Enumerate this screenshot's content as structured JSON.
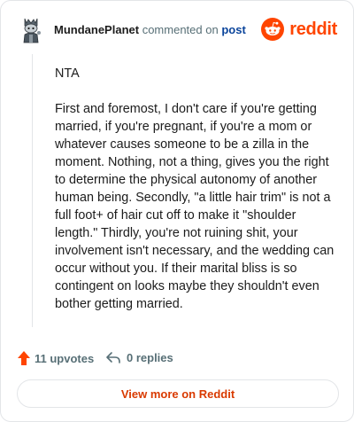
{
  "header": {
    "username": "MundanePlanet",
    "verb": "commented on",
    "post_link": "post",
    "brand": "reddit"
  },
  "comment": {
    "paragraphs": [
      "NTA",
      "First and foremost, I don't care if you're getting married, if you're pregnant, if you're a mom or whatever causes someone to be a zilla in the moment. Nothing, not a thing, gives you the right to determine the physical autonomy of another human being. Secondly, \"a little hair trim\" is not a full foot+ of hair cut off to make it \"shoulder length.\" Thirdly, you're not ruining shit, your involvement isn't necessary, and the wedding can occur without you. If their marital bliss is so contingent on looks maybe they shouldn't even bother getting married."
    ]
  },
  "footer": {
    "upvotes": "11 upvotes",
    "replies": "0 replies",
    "view_more": "View more on Reddit"
  },
  "colors": {
    "brand": "#ff4500",
    "link": "#0a449b",
    "button_text": "#d93a00",
    "muted": "#576f76",
    "border": "#e3e5e8"
  },
  "icons": {
    "avatar": "snoo-avatar-icon",
    "brand_logo": "reddit-snoo-icon",
    "upvote": "upvote-arrow-icon",
    "reply": "reply-arrow-icon"
  }
}
